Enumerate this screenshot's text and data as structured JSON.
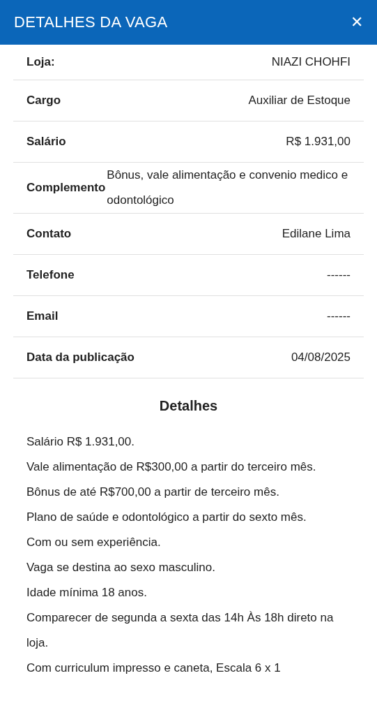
{
  "header": {
    "title": "DETALHES DA VAGA",
    "close": "✕"
  },
  "fields": [
    {
      "label": "Loja:",
      "value": "NIAZI CHOHFI",
      "kind": "right"
    },
    {
      "label": "Cargo",
      "value": "Auxiliar de Estoque",
      "kind": "right"
    },
    {
      "label": "Salário",
      "value": "R$ 1.931,00",
      "kind": "right"
    },
    {
      "label": "Complemento",
      "value": "Bônus, vale alimentação e convenio medico e odontológico",
      "kind": "wrap"
    },
    {
      "label": "Contato",
      "value": "Edilane Lima",
      "kind": "right"
    },
    {
      "label": "Telefone",
      "value": "------",
      "kind": "right"
    },
    {
      "label": "Email",
      "value": "------",
      "kind": "right"
    },
    {
      "label": "Data da publicação",
      "value": "04/08/2025",
      "kind": "right"
    }
  ],
  "details": {
    "title": "Detalhes",
    "lines": [
      "Salário R$ 1.931,00.",
      "Vale alimentação de R$300,00 a partir do terceiro mês.",
      "Bônus de até R$700,00 a partir de terceiro mês.",
      "Plano de saúde e odontológico a partir do sexto mês.",
      "Com ou sem experiência.",
      "Vaga se destina ao sexo masculino.",
      "Idade mínima 18 anos.",
      "Comparecer de segunda a sexta das 14h Às 18h direto na loja.",
      "Com curriculum impresso e caneta, Escala 6 x 1"
    ]
  }
}
